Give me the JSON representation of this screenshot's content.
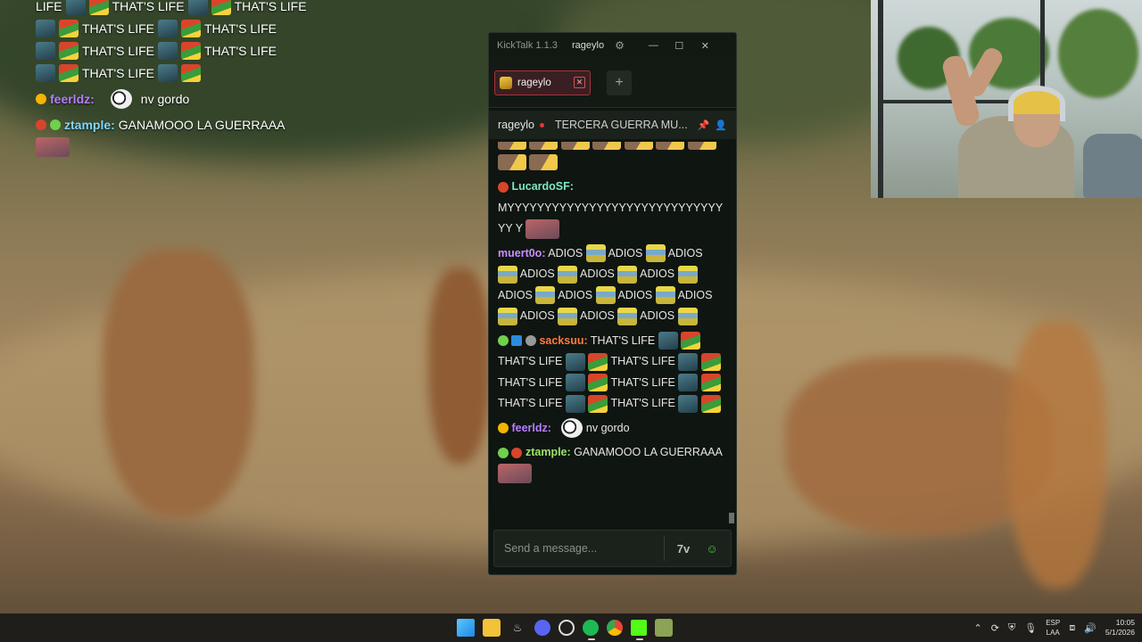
{
  "overlay_chat": {
    "lines": [
      {
        "type": "emote_text",
        "text": "LIFE"
      },
      {
        "text": "THAT'S LIFE"
      },
      {
        "user": "feerldz:",
        "message": "nv gordo",
        "user_color": "#b67dff"
      },
      {
        "user": "ztample:",
        "message": "GANAMOOO LA GUERRAAA",
        "user_color": "#7fd6ff"
      }
    ],
    "thats_life": "THAT'S LIFE",
    "life": "LIFE"
  },
  "kicktalk": {
    "app_version": "KickTalk 1.1.3",
    "title_user": "rageylo",
    "tab_label": "rageylo",
    "add_tab_label": "+",
    "stream_user": "rageylo",
    "stream_title": "TERCERA GUERRA MU...",
    "input_placeholder": "Send a message...",
    "messages": [
      {
        "user": "LucardoSF:",
        "user_color": "#7fe7c4",
        "text": "MYYYYYYYYYYYYYYYYYYYYYYYYYYYYYYY Y"
      },
      {
        "user": "muert0o:",
        "user_color": "#c98dff",
        "words": [
          "ADIOS",
          "ADIOS",
          "ADIOS",
          "ADIOS",
          "ADIOS",
          "ADIOS",
          "ADIOS",
          "ADIOS",
          "ADIOS",
          "ADIOS",
          "ADIOS",
          "ADIOS",
          "ADIOS"
        ]
      },
      {
        "user": "sacksuu:",
        "user_color": "#ff7a3d",
        "text": "THAT'S LIFE"
      },
      {
        "user": "feerldz:",
        "user_color": "#b67dff",
        "text": "nv gordo"
      },
      {
        "user": "ztample:",
        "user_color": "#9be36b",
        "text": "GANAMOOO LA GUERRAAA"
      }
    ],
    "colors": {
      "kick_green": "#53c93f",
      "tab_border": "#a4333a"
    }
  },
  "taskbar": {
    "apps": [
      "windows-start",
      "file-explorer",
      "steam",
      "discord",
      "obs",
      "spotify",
      "chrome",
      "kick",
      "kicktalk"
    ],
    "language_top": "ESP",
    "language_bottom": "LAA",
    "time": "10:05",
    "date": "5/1/2026"
  }
}
